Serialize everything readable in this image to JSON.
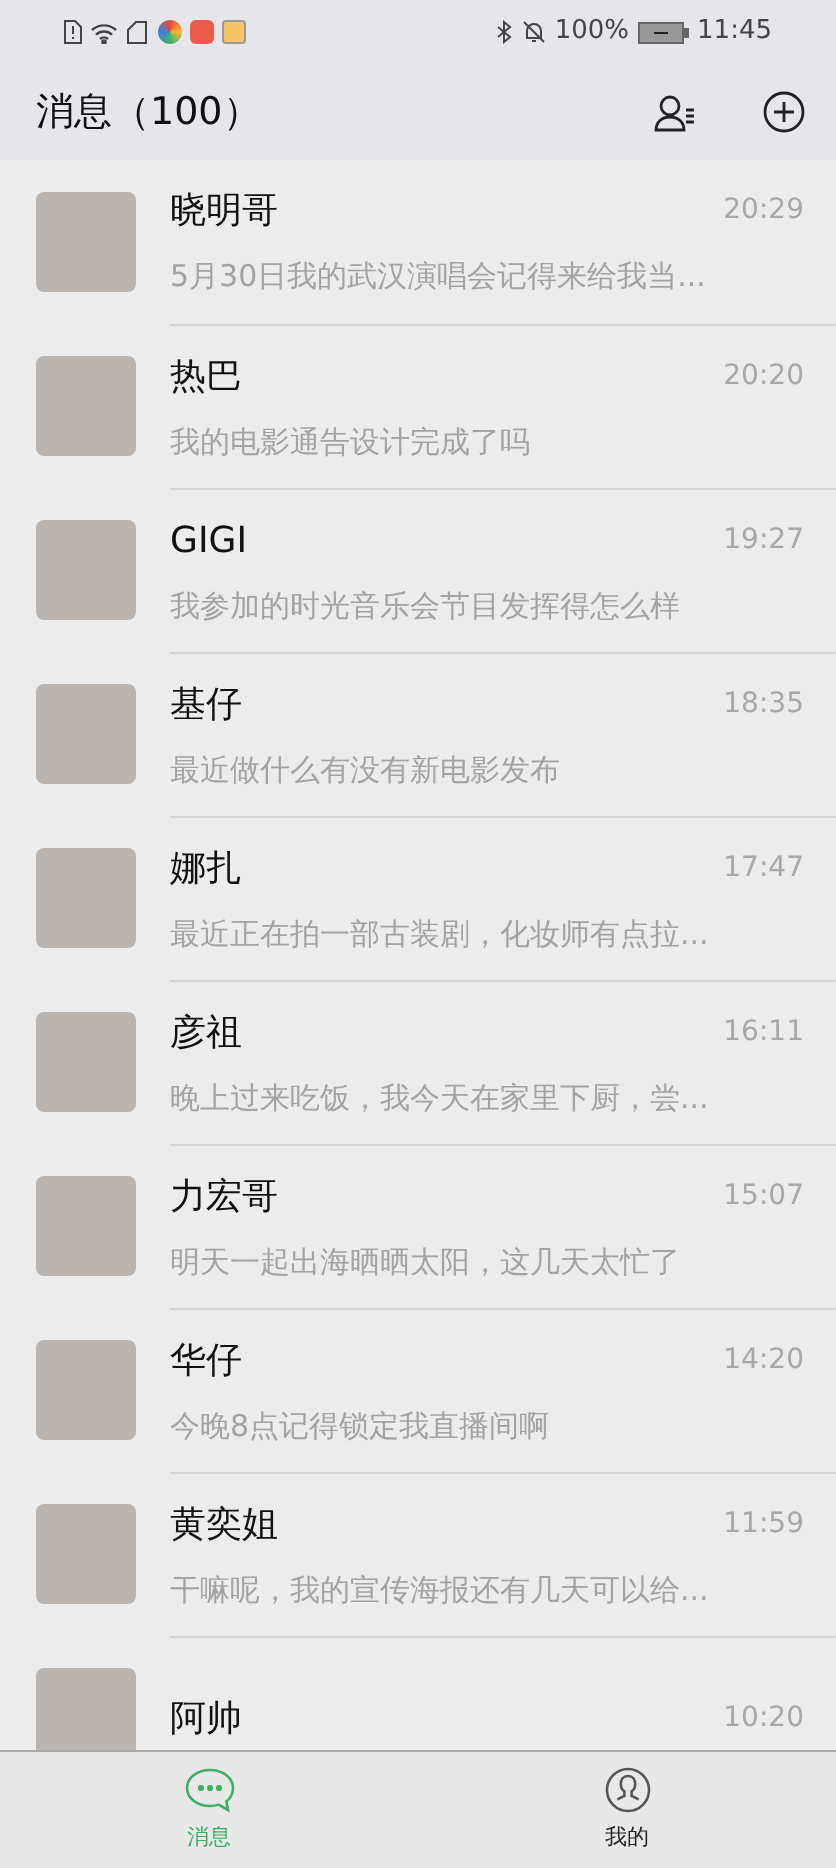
{
  "status_bar": {
    "battery": "100%",
    "time": "11:45"
  },
  "header": {
    "title": "消息（100）"
  },
  "conversations": [
    {
      "name": "晓明哥",
      "time": "20:29",
      "preview": "5月30日我的武汉演唱会记得来给我当..."
    },
    {
      "name": "热巴",
      "time": "20:20",
      "preview": "我的电影通告设计完成了吗"
    },
    {
      "name": "GIGI",
      "time": "19:27",
      "preview": "我参加的时光音乐会节目发挥得怎么样"
    },
    {
      "name": "基仔",
      "time": "18:35",
      "preview": "最近做什么有没有新电影发布"
    },
    {
      "name": "娜扎",
      "time": "17:47",
      "preview": "最近正在拍一部古装剧，化妆师有点拉..."
    },
    {
      "name": "彦祖",
      "time": "16:11",
      "preview": "晚上过来吃饭，我今天在家里下厨，尝..."
    },
    {
      "name": "力宏哥",
      "time": "15:07",
      "preview": "明天一起出海晒晒太阳，这几天太忙了"
    },
    {
      "name": "华仔",
      "time": "14:20",
      "preview": "今晚8点记得锁定我直播间啊"
    },
    {
      "name": "黄奕姐",
      "time": "11:59",
      "preview": "干嘛呢，我的宣传海报还有几天可以给..."
    },
    {
      "name": "阿帅",
      "time": "10:20"
    }
  ],
  "tabs": [
    {
      "label": "消息",
      "kind": "chat",
      "selected": true
    },
    {
      "label": "我的",
      "kind": "profile",
      "selected": false
    }
  ]
}
